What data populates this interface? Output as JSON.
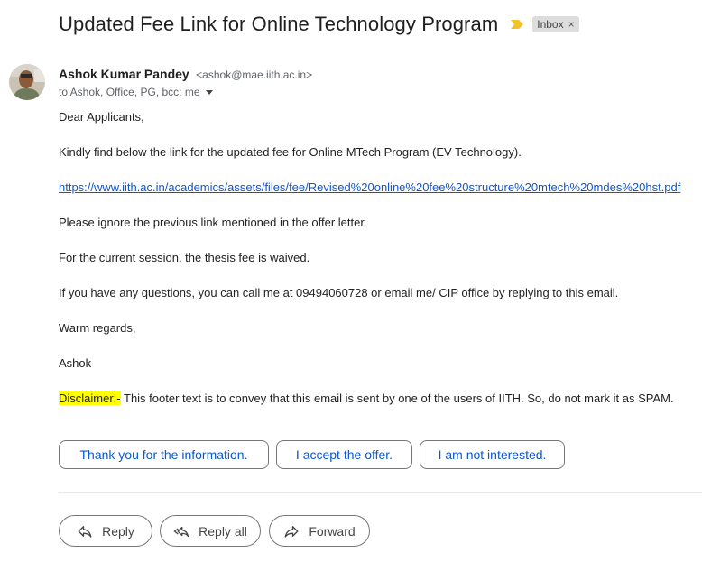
{
  "email": {
    "subject": "Updated Fee Link for Online Technology Program",
    "label": "Inbox",
    "label_close": "×",
    "sender_name": "Ashok Kumar Pandey",
    "sender_email": "<ashok@mae.iith.ac.in>",
    "recipients": "to Ashok, Office, PG, bcc: me",
    "body": {
      "greeting": "Dear Applicants,",
      "line1": "Kindly find below the link for the updated fee for Online MTech Program (EV Technology).",
      "link": "https://www.iith.ac.in/academics/assets/files/fee/Revised%20online%20fee%20structure%20mtech%20mdes%20hst.pdf",
      "line2": "Please ignore the previous link mentioned in the offer letter.",
      "line3": "For the current session, the thesis fee is waived.",
      "line4": "If you have any questions, you can call me at 09494060728 or email me/ CIP office by replying to this email.",
      "signoff": "Warm regards,",
      "signature": "Ashok",
      "disclaimer_label": "Disclaimer:-",
      "disclaimer_text": " This footer text is to convey that this email is sent by one of the users of IITH. So, do not mark it as SPAM."
    }
  },
  "smart_replies": [
    "Thank you for the information.",
    "I accept the offer.",
    "I am not interested."
  ],
  "actions": {
    "reply": "Reply",
    "reply_all": "Reply all",
    "forward": "Forward"
  },
  "icons": {
    "importance": "importance-marker-icon",
    "dropdown": "chevron-down-icon",
    "reply": "reply-icon",
    "reply_all": "reply-all-icon",
    "forward": "forward-icon"
  },
  "colors": {
    "importance": "#f2c12e",
    "link": "#1155cc",
    "highlight": "#ffff00",
    "smart_reply_text": "#0b57d0"
  }
}
